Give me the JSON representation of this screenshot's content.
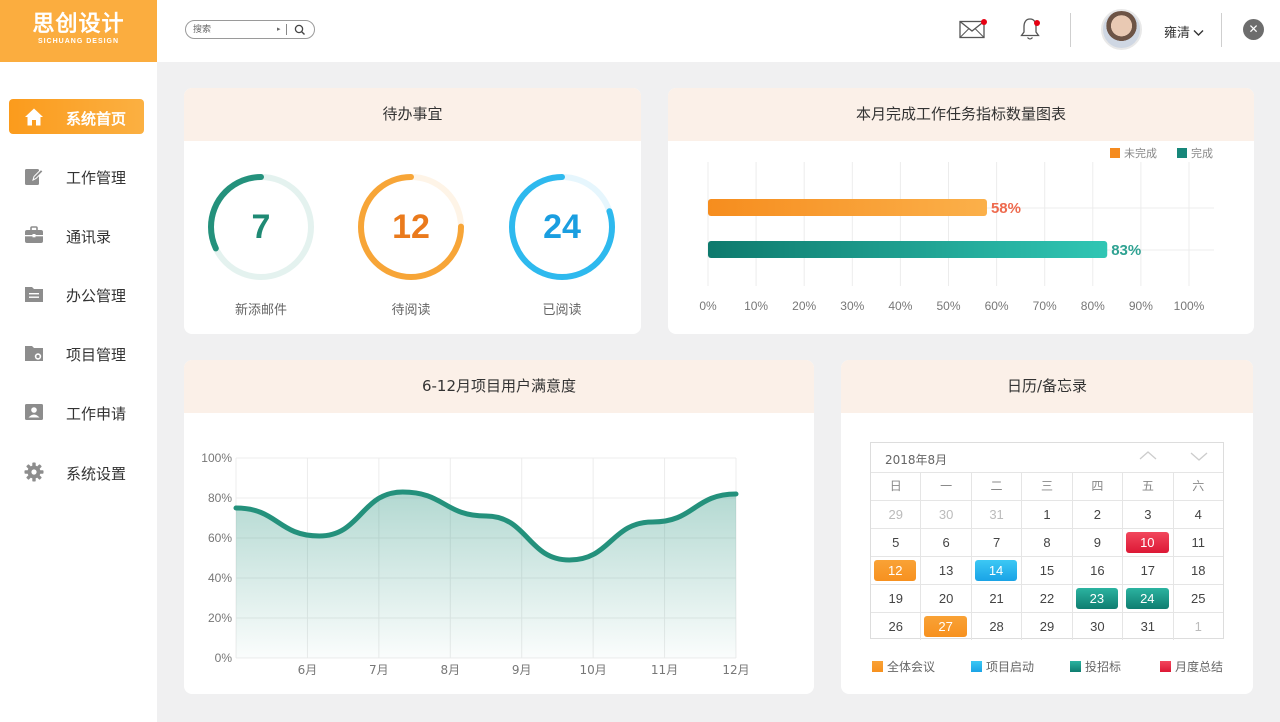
{
  "brand": {
    "name": "思创设计",
    "subtitle": "SICHUANG DESIGN"
  },
  "header": {
    "search_placeholder": "搜索",
    "user_name": "雍清",
    "mail_icon": "mail-icon",
    "bell_icon": "bell-icon",
    "close_icon": "close-icon",
    "notification_dot_color": "#e60012"
  },
  "sidebar": {
    "items": [
      {
        "label": "系统首页",
        "icon": "home-icon",
        "active": true
      },
      {
        "label": "工作管理",
        "icon": "edit-icon",
        "active": false
      },
      {
        "label": "通讯录",
        "icon": "briefcase-icon",
        "active": false
      },
      {
        "label": "办公管理",
        "icon": "folder-icon",
        "active": false
      },
      {
        "label": "项目管理",
        "icon": "folder-settings-icon",
        "active": false
      },
      {
        "label": "工作申请",
        "icon": "contact-card-icon",
        "active": false
      },
      {
        "label": "系统设置",
        "icon": "gear-icon",
        "active": false
      }
    ]
  },
  "todo": {
    "title": "待办事宜",
    "items": [
      {
        "value": "7",
        "label": "新添邮件",
        "fraction": 0.32,
        "color": "#24917c"
      },
      {
        "value": "12",
        "label": "待阅读",
        "fraction": 0.75,
        "color": "#f7a537"
      },
      {
        "value": "24",
        "label": "已阅读",
        "fraction": 0.8,
        "color": "#2eb9ee"
      }
    ]
  },
  "tasks": {
    "title": "本月完成工作任务指标数量图表",
    "legend": [
      {
        "label": "未完成",
        "color": "#f58b1f"
      },
      {
        "label": "完成",
        "color": "#17877a"
      }
    ],
    "bars": [
      {
        "value": 58,
        "label": "58%",
        "color_from": "#f68d1e",
        "color_to": "#fbb04a",
        "label_color": "#ee6a4e"
      },
      {
        "value": 83,
        "label": "83%",
        "color_from": "#0e7a6d",
        "color_to": "#30c6b4",
        "label_color": "#2fa292"
      }
    ],
    "xticks": [
      "0%",
      "10%",
      "20%",
      "30%",
      "40%",
      "50%",
      "60%",
      "70%",
      "80%",
      "90%",
      "100%"
    ]
  },
  "chart_data": {
    "type": "area",
    "title": "6-12月项目用户满意度",
    "x": [
      "6月",
      "7月",
      "8月",
      "9月",
      "10月",
      "11月",
      "12月"
    ],
    "y": [
      75,
      61,
      83,
      71,
      49,
      68,
      82
    ],
    "yticks": [
      "0%",
      "20%",
      "40%",
      "60%",
      "80%",
      "100%"
    ],
    "ylim": [
      0,
      100
    ],
    "grid": true,
    "color": "#24917c"
  },
  "calendar": {
    "title": "日历/备忘录",
    "month_label": "2018年8月",
    "weekdays": [
      "日",
      "一",
      "二",
      "三",
      "四",
      "五",
      "六"
    ],
    "weeks": [
      [
        {
          "d": "29",
          "m": 1
        },
        {
          "d": "30",
          "m": 1
        },
        {
          "d": "31",
          "m": 1
        },
        {
          "d": "1"
        },
        {
          "d": "2"
        },
        {
          "d": "3"
        },
        {
          "d": "4"
        }
      ],
      [
        {
          "d": "5"
        },
        {
          "d": "6"
        },
        {
          "d": "7"
        },
        {
          "d": "8"
        },
        {
          "d": "9"
        },
        {
          "d": "10",
          "t": "summary"
        },
        {
          "d": "11"
        }
      ],
      [
        {
          "d": "12",
          "t": "meeting"
        },
        {
          "d": "13"
        },
        {
          "d": "14",
          "t": "launch"
        },
        {
          "d": "15"
        },
        {
          "d": "16"
        },
        {
          "d": "17"
        },
        {
          "d": "18"
        }
      ],
      [
        {
          "d": "19"
        },
        {
          "d": "20"
        },
        {
          "d": "21"
        },
        {
          "d": "22"
        },
        {
          "d": "23",
          "t": "bid"
        },
        {
          "d": "24",
          "t": "bid"
        },
        {
          "d": "25"
        }
      ],
      [
        {
          "d": "26"
        },
        {
          "d": "27",
          "t": "meeting"
        },
        {
          "d": "28"
        },
        {
          "d": "29"
        },
        {
          "d": "30"
        },
        {
          "d": "31"
        },
        {
          "d": "1",
          "m": 1
        }
      ]
    ],
    "legend": [
      {
        "key": "meeting",
        "label": "全体会议",
        "color_from": "#f9a236",
        "color_to": "#f7911f"
      },
      {
        "key": "launch",
        "label": "项目启动",
        "color_from": "#3cc8f4",
        "color_to": "#1aa3e6"
      },
      {
        "key": "bid",
        "label": "投招标",
        "color_from": "#2bb3a0",
        "color_to": "#0f7d70"
      },
      {
        "key": "summary",
        "label": "月度总结",
        "color_from": "#f2475d",
        "color_to": "#dd1835"
      }
    ]
  }
}
